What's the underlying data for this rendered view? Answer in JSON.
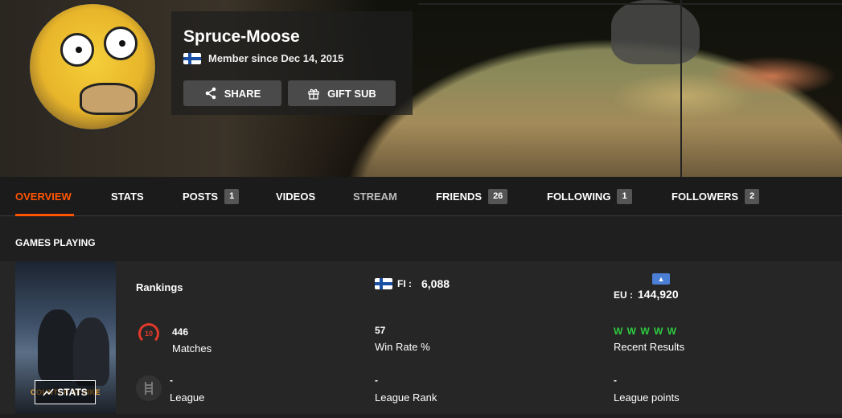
{
  "profile": {
    "username": "Spruce-Moose",
    "member_since": "Member since Dec 14, 2015",
    "share_label": "SHARE",
    "gift_label": "GIFT SUB"
  },
  "nav": {
    "tabs": [
      {
        "label": "OVERVIEW"
      },
      {
        "label": "STATS"
      },
      {
        "label": "POSTS",
        "count": "1"
      },
      {
        "label": "VIDEOS"
      },
      {
        "label": "STREAM"
      },
      {
        "label": "FRIENDS",
        "count": "26"
      },
      {
        "label": "FOLLOWING",
        "count": "1"
      },
      {
        "label": "FOLLOWERS",
        "count": "2"
      }
    ]
  },
  "games": {
    "section_title": "GAMES PLAYING",
    "stats_button": "STATS",
    "cover_logo": "COUNTER STRIKE",
    "rankings_label": "Rankings",
    "country_code": "FI :",
    "country_rank": "6,088",
    "region_code": "EU :",
    "region_rank": "144,920",
    "skill_level": "10",
    "matches_value": "446",
    "matches_label": "Matches",
    "winrate_value": "57",
    "winrate_label": "Win Rate %",
    "recent_results": "W W W W W",
    "recent_label": "Recent Results",
    "league_value": "-",
    "league_label": "League",
    "league_rank_value": "-",
    "league_rank_label": "League Rank",
    "league_points_value": "-",
    "league_points_label": "League points"
  },
  "colors": {
    "accent": "#ff5500",
    "win": "#2ecc40",
    "skill": "#e23a2a"
  }
}
